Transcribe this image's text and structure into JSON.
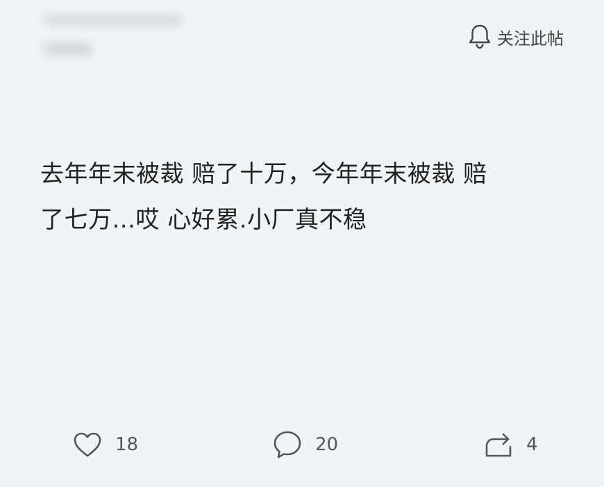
{
  "header": {
    "follow_label": "关注此帖"
  },
  "post": {
    "line1": "去年年末被裁 赔了十万，今年年末被裁 赔",
    "line2": "了七万...哎 心好累.小厂真不稳"
  },
  "actions": {
    "like_count": "18",
    "comment_count": "20",
    "share_count": "4"
  },
  "icons": {
    "follow": "bell-icon",
    "like": "heart-icon",
    "comment": "comment-bubble-icon",
    "share": "share-arrow-icon"
  },
  "colors": {
    "background": "#f1f4f6",
    "text": "#222222",
    "muted": "#555555"
  }
}
